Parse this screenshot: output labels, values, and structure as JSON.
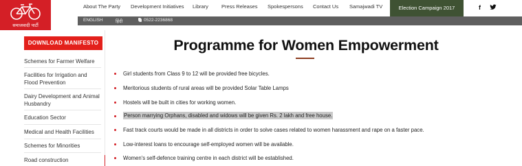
{
  "logo": {
    "name": "समाजवादी पार्टी"
  },
  "nav": {
    "items": [
      "About The Party",
      "Development Initiatives",
      "Library",
      "Press Releases",
      "Spokespersons",
      "Contact Us",
      "Samajwadi TV"
    ],
    "election_campaign": "Election Campaign 2017",
    "social": [
      "facebook-icon",
      "twitter-icon"
    ]
  },
  "sub_bar": {
    "lang_english": "ENGLISH",
    "lang_hindi": "हिंदी",
    "phone": "0522-2236868"
  },
  "sidebar": {
    "download_label": "DOWNLOAD MANIFESTO",
    "items": [
      "Schemes for Farmer Welfare",
      "Facilities for Irrigation and Flood Prevention",
      "Dairy Development and Animal Husbandry",
      "Education Sector",
      "Medical and Health Facilities",
      "Schemes for Minorities",
      "Road construction"
    ]
  },
  "main": {
    "title": "Programme for Women Empowerment",
    "points": [
      "Girl students from Class 9 to 12 will be provided free bicycles.",
      "Meritorious students of rural areas will be provided Solar Table Lamps",
      "Hostels will be built in cities for working women.",
      "Person marrying Orphans, disabled and widows will be given Rs. 2 lakh and free house.",
      "Fast track courts would be made in all districts in order to solve cases related to women harassment and rape on a faster pace.",
      "Low-interest loans to encourage self-employed women will be available.",
      "Women's self-defence training centre in each district will be established."
    ],
    "highlighted_index": 3
  },
  "colors": {
    "brand_red": "#d41f26",
    "election_green": "#3f5233",
    "sub_bar_gray": "#5f5f5f",
    "title_underline": "#8b3a1d"
  }
}
